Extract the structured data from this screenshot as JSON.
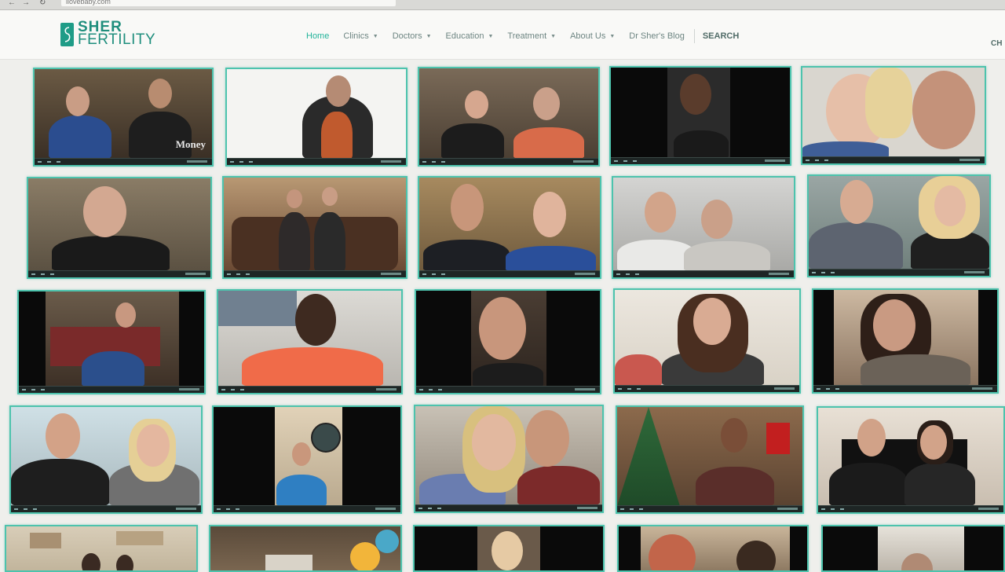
{
  "browser": {
    "url": "ilovebaby.com"
  },
  "logo": {
    "line1": "SHER",
    "line2": "FERTILITY"
  },
  "nav": {
    "items": [
      {
        "label": "Home",
        "dropdown": false,
        "active": true
      },
      {
        "label": "Clinics",
        "dropdown": true
      },
      {
        "label": "Doctors",
        "dropdown": true
      },
      {
        "label": "Education",
        "dropdown": true
      },
      {
        "label": "Treatment",
        "dropdown": true
      },
      {
        "label": "About Us",
        "dropdown": true
      },
      {
        "label": "Dr Sher's Blog",
        "dropdown": false
      }
    ],
    "search_label": "SEARCH",
    "edge_text": "CH"
  },
  "colors": {
    "accent": "#23b39a",
    "tile_border": "#4dc3ad",
    "brand": "#1f8e7d"
  },
  "video_grid": {
    "tiles": [
      {
        "overlay": "Money"
      },
      {},
      {},
      {},
      {},
      {},
      {},
      {},
      {},
      {},
      {},
      {},
      {},
      {},
      {},
      {},
      {},
      {},
      {},
      {},
      {},
      {},
      {},
      {},
      {}
    ]
  }
}
